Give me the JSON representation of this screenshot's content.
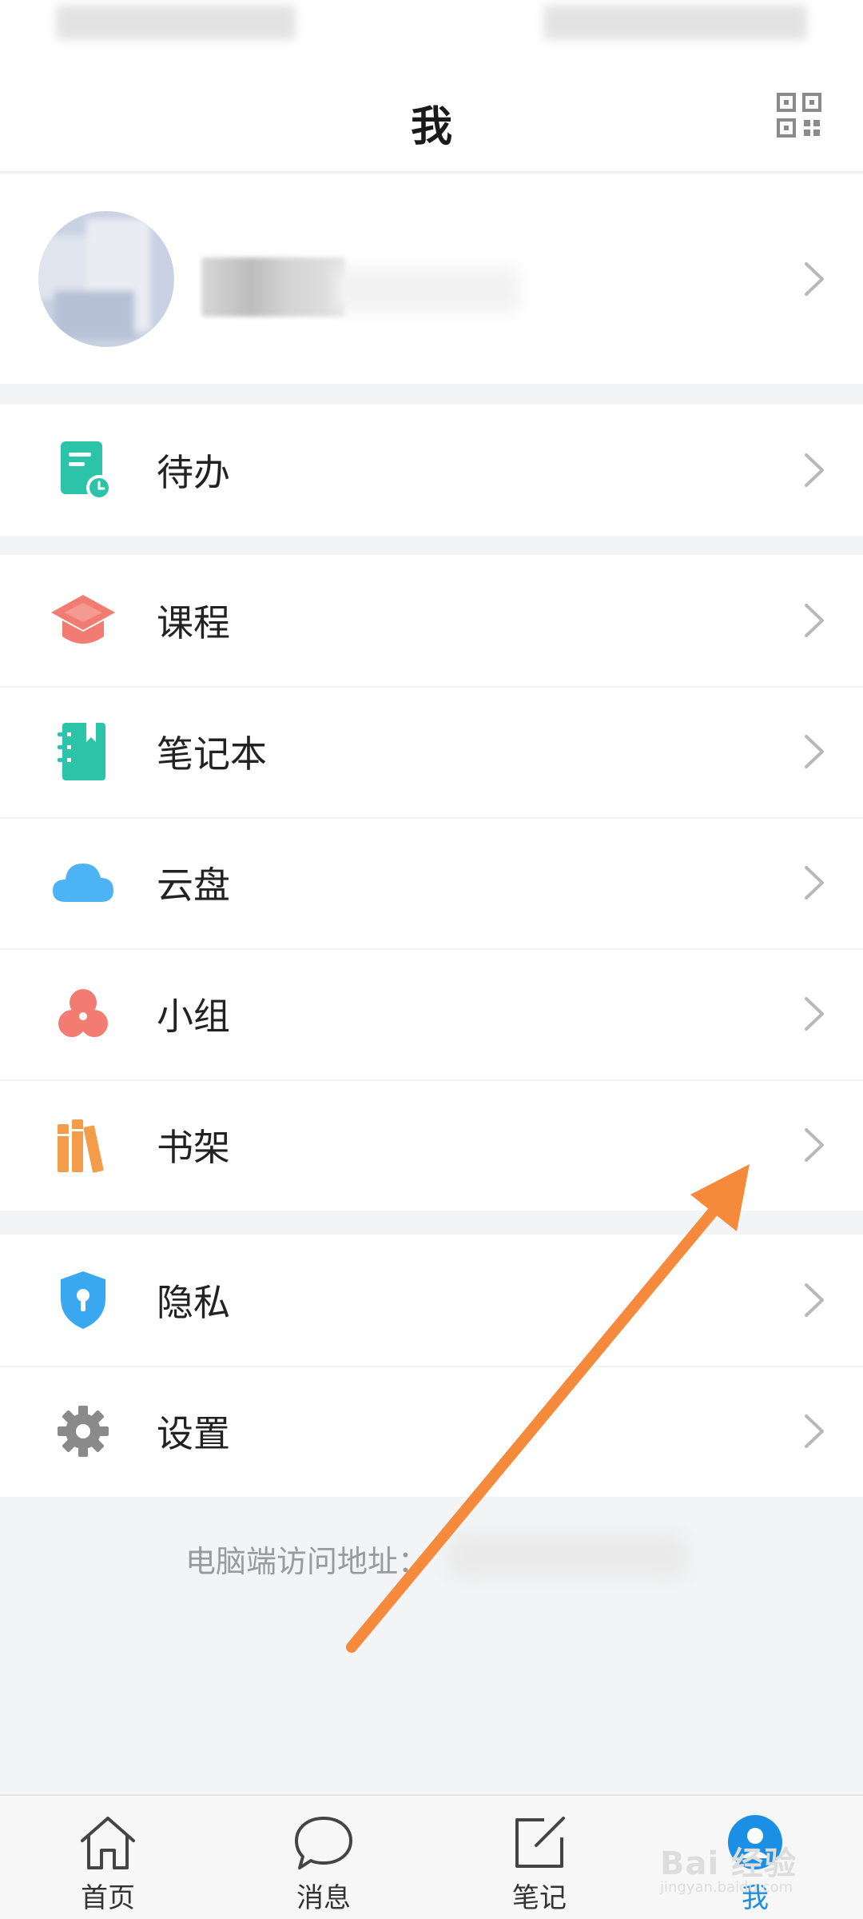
{
  "header": {
    "title": "我"
  },
  "groups": [
    {
      "items": [
        {
          "label": "待办",
          "icon": "todo-clock-icon"
        }
      ]
    },
    {
      "items": [
        {
          "label": "课程",
          "icon": "course-mortarboard-icon"
        },
        {
          "label": "笔记本",
          "icon": "notebook-icon"
        },
        {
          "label": "云盘",
          "icon": "cloud-icon"
        },
        {
          "label": "小组",
          "icon": "group-icon"
        },
        {
          "label": "书架",
          "icon": "bookshelf-icon"
        }
      ]
    },
    {
      "items": [
        {
          "label": "隐私",
          "icon": "privacy-shield-icon"
        },
        {
          "label": "设置",
          "icon": "gear-icon"
        }
      ]
    }
  ],
  "footer": {
    "text": "电脑端访问地址："
  },
  "tabs": [
    {
      "label": "首页",
      "icon": "home-icon"
    },
    {
      "label": "消息",
      "icon": "message-icon"
    },
    {
      "label": "笔记",
      "icon": "note-edit-icon"
    },
    {
      "label": "我",
      "icon": "me-icon",
      "active": true
    }
  ],
  "watermark": {
    "main": "Bai 经验",
    "sub": "jingyan.baidu.com"
  },
  "colors": {
    "accent": "#1a8fe3",
    "todo": "#2cc4a8",
    "course": "#f27b72",
    "notebook": "#2cc4a8",
    "cloud": "#4cb3f5",
    "group": "#f27b72",
    "bookshelf": "#f39c4a",
    "privacy": "#3aa8f0",
    "settings": "#8a8a8a",
    "annotation_arrow": "#f58a3c"
  }
}
